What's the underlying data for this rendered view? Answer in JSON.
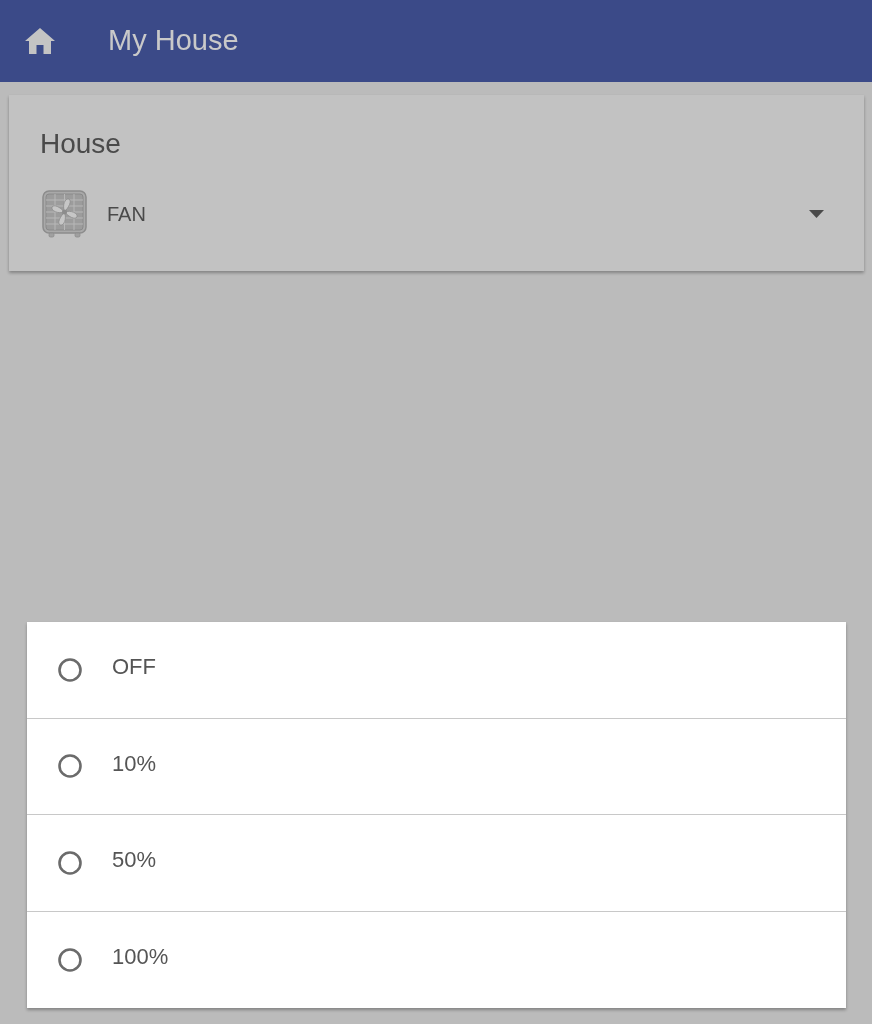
{
  "app_bar": {
    "title": "My House"
  },
  "card": {
    "title": "House",
    "device": {
      "label": "FAN"
    }
  },
  "options": [
    {
      "label": "OFF",
      "selected": false
    },
    {
      "label": "10%",
      "selected": false
    },
    {
      "label": "50%",
      "selected": false
    },
    {
      "label": "100%",
      "selected": false
    }
  ]
}
